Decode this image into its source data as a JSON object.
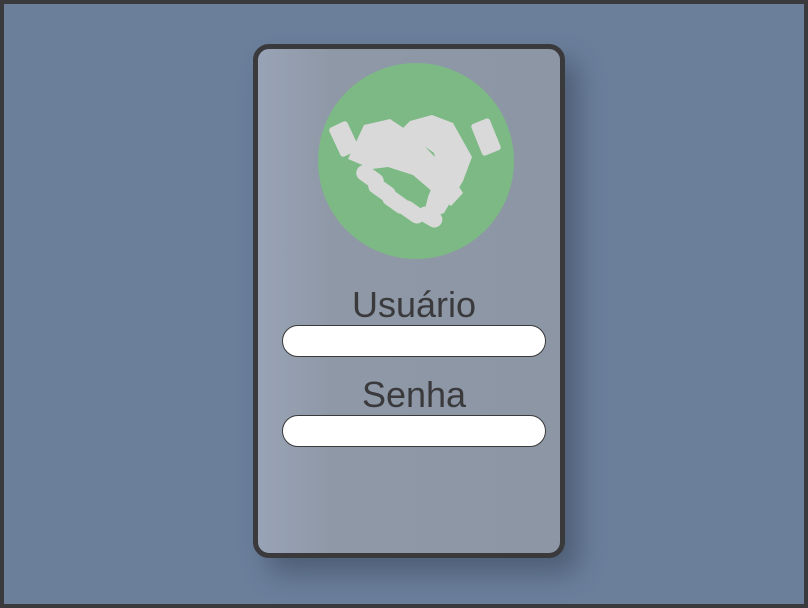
{
  "login": {
    "logo_icon": "handshake-icon",
    "username_label": "Usuário",
    "username_value": "",
    "password_label": "Senha",
    "password_value": ""
  },
  "colors": {
    "background": "#6b7f9b",
    "frame": "#3a3a3c",
    "card": "#8e98a6",
    "logo_circle": "#7db985",
    "icon": "#d9d9d9"
  }
}
